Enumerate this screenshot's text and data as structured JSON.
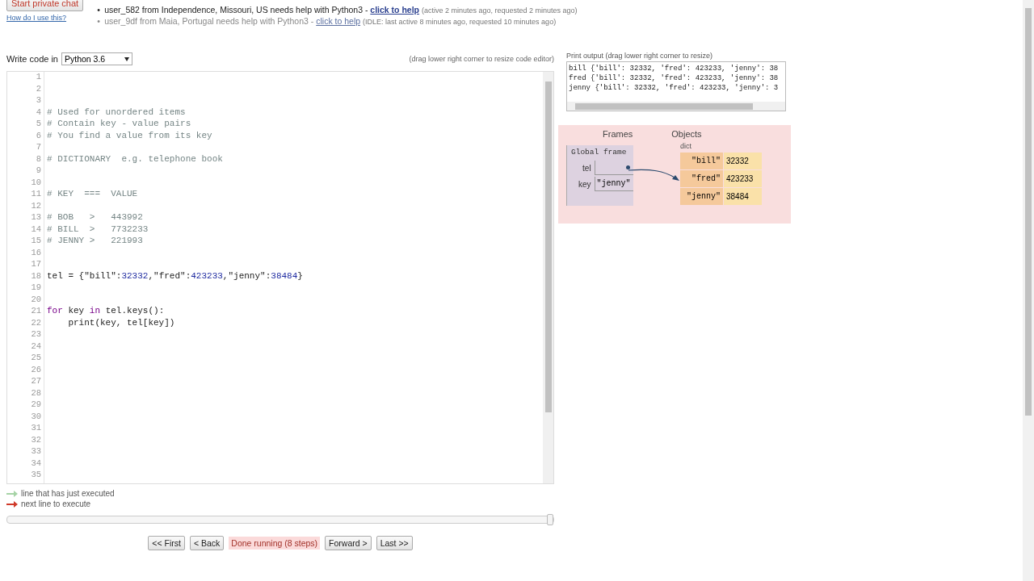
{
  "help_requests": [
    {
      "bullet": "•",
      "user": "user_582 from Independence, Missouri, US needs help with Python3 - ",
      "link": "click to help",
      "note": "(active 2 minutes ago, requested 2 minutes ago)",
      "idle": false
    },
    {
      "bullet": "•",
      "user": "user_9df from Maia, Portugal needs help with Python3 - ",
      "link": "click to help",
      "note": "(IDLE: last active 8 minutes ago, requested 10 minutes ago)",
      "idle": true
    }
  ],
  "private_chat_button": "Start private chat",
  "help_link": "How do I use this?",
  "write_code_label": "Write code in",
  "language": "Python 3.6",
  "resize_hint": "(drag lower right corner to resize code editor)",
  "code_lines": [
    {
      "number": "1"
    },
    {
      "number": "2"
    },
    {
      "number": "3"
    },
    {
      "number": "4",
      "segments": [
        {
          "kind": "comment",
          "text": "# Used for unordered items"
        }
      ]
    },
    {
      "number": "5",
      "segments": [
        {
          "kind": "comment",
          "text": "# Contain key - value pairs"
        }
      ]
    },
    {
      "number": "6",
      "segments": [
        {
          "kind": "comment",
          "text": "# You find a value from its key"
        }
      ]
    },
    {
      "number": "7"
    },
    {
      "number": "8",
      "segments": [
        {
          "kind": "comment",
          "text": "# DICTIONARY  e.g. telephone book"
        }
      ]
    },
    {
      "number": "9"
    },
    {
      "number": "10"
    },
    {
      "number": "11",
      "segments": [
        {
          "kind": "comment",
          "text": "# KEY  ===  VALUE"
        }
      ]
    },
    {
      "number": "12"
    },
    {
      "number": "13",
      "segments": [
        {
          "kind": "comment",
          "text": "# BOB   >   443992"
        }
      ]
    },
    {
      "number": "14",
      "segments": [
        {
          "kind": "comment",
          "text": "# BILL  >   7732233"
        }
      ]
    },
    {
      "number": "15",
      "segments": [
        {
          "kind": "comment",
          "text": "# JENNY >   221993"
        }
      ]
    },
    {
      "number": "16"
    },
    {
      "number": "17"
    },
    {
      "number": "18",
      "segments": [
        {
          "kind": "text",
          "text": "tel = {\"bill\":"
        },
        {
          "kind": "number",
          "text": "32332"
        },
        {
          "kind": "text",
          "text": ",\"fred\":"
        },
        {
          "kind": "number",
          "text": "423233"
        },
        {
          "kind": "text",
          "text": ",\"jenny\":"
        },
        {
          "kind": "number",
          "text": "38484"
        },
        {
          "kind": "text",
          "text": "}"
        }
      ]
    },
    {
      "number": "19"
    },
    {
      "number": "20"
    },
    {
      "number": "21",
      "segments": [
        {
          "kind": "keyword",
          "text": "for"
        },
        {
          "kind": "text",
          "text": " key "
        },
        {
          "kind": "keyword",
          "text": "in"
        },
        {
          "kind": "text",
          "text": " tel.keys():"
        }
      ]
    },
    {
      "number": "22",
      "segments": [
        {
          "kind": "text",
          "text": "    print(key, tel[key])"
        }
      ]
    },
    {
      "number": "23"
    },
    {
      "number": "24"
    },
    {
      "number": "25"
    },
    {
      "number": "26"
    },
    {
      "number": "27"
    },
    {
      "number": "28"
    },
    {
      "number": "29"
    },
    {
      "number": "30"
    },
    {
      "number": "31"
    },
    {
      "number": "32"
    },
    {
      "number": "33"
    },
    {
      "number": "34"
    },
    {
      "number": "35"
    }
  ],
  "print_output": {
    "title": "Print output (drag lower right corner to resize)",
    "lines": [
      "bill {'bill': 32332, 'fred': 423233, 'jenny': 38",
      "fred {'bill': 32332, 'fred': 423233, 'jenny': 38",
      "jenny {'bill': 32332, 'fred': 423233, 'jenny': 3"
    ]
  },
  "visualization": {
    "frames_heading": "Frames",
    "objects_heading": "Objects",
    "frame_title": "Global frame",
    "variables": [
      {
        "name": "tel",
        "kind": "pointer"
      },
      {
        "name": "key",
        "kind": "value",
        "value": "\"jenny\""
      }
    ],
    "object_type": "dict",
    "entries": [
      {
        "key": "\"bill\"",
        "value": "32332"
      },
      {
        "key": "\"fred\"",
        "value": "423233"
      },
      {
        "key": "\"jenny\"",
        "value": "38484"
      }
    ]
  },
  "legend": [
    {
      "label": "line that has just executed",
      "color": "#a6d3a6"
    },
    {
      "label": "next line to execute",
      "color": "#d03a2a"
    }
  ],
  "step_slider": {
    "level": 1
  },
  "controls": [
    {
      "kind": "button",
      "label": "<< First"
    },
    {
      "kind": "button",
      "label": "< Back"
    },
    {
      "kind": "status",
      "label": "Done running (8 steps)"
    },
    {
      "kind": "button",
      "label": "Forward >"
    },
    {
      "kind": "button",
      "label": "Last >>"
    }
  ]
}
